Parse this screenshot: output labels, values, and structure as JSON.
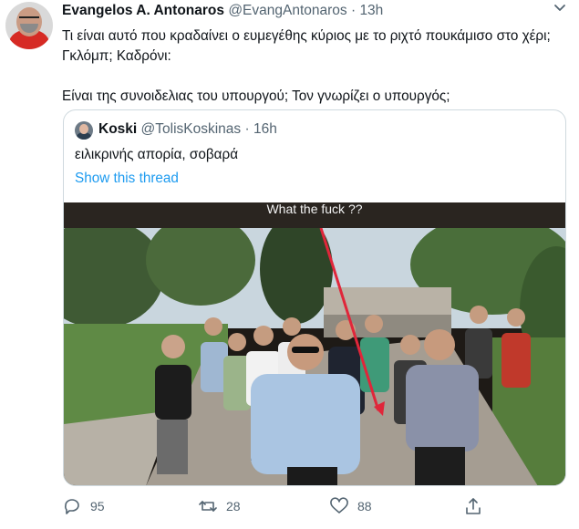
{
  "tweet": {
    "author": {
      "display_name": "Evangelos A. Antonaros",
      "handle": "@EvangAntonaros",
      "time": "13h"
    },
    "separator": " · ",
    "text": "Τι είναι αυτό που κραδαίνει ο ευμεγέθης κύριος με το ριχτό πουκάμισο στο χέρι; Γκλόμπ; Καδρόνι:\n\nΕίναι της συνοιδελιας του υπουργού; Τον γνωρίζει ο υπουργός;",
    "menu_icon": "chevron-down-icon"
  },
  "quote": {
    "author": {
      "display_name": "Koski",
      "handle": "@TolisKoskinas",
      "time": "16h"
    },
    "text": "ειλικρινής απορία, σοβαρά",
    "show_thread": "Show this thread",
    "media": {
      "caption": "What the fuck ??",
      "annotation_color": "#e0263a"
    }
  },
  "actions": {
    "reply": {
      "icon": "reply-icon",
      "count": "95"
    },
    "retweet": {
      "icon": "retweet-icon",
      "count": "28"
    },
    "like": {
      "icon": "heart-icon",
      "count": "88"
    },
    "share": {
      "icon": "share-icon"
    }
  },
  "colors": {
    "link": "#1d9bf0",
    "secondary_text": "#536471",
    "border": "#cfd9de"
  }
}
